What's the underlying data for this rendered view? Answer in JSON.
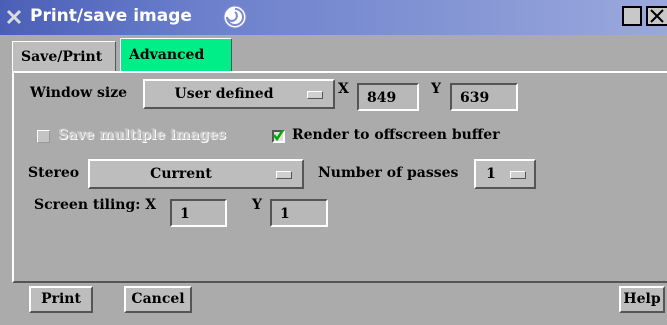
{
  "window": {
    "title": "Print/save image"
  },
  "tabs": [
    {
      "label": "Save/Print"
    },
    {
      "label": "Advanced"
    }
  ],
  "window_size": {
    "label": "Window size",
    "menu_value": "User defined",
    "x_label": "X",
    "x_value": "849",
    "y_label": "Y",
    "y_value": "639"
  },
  "save_multiple": {
    "label": "Save multiple images",
    "checked": false,
    "enabled": false
  },
  "offscreen": {
    "label": "Render to offscreen buffer",
    "checked": true
  },
  "stereo": {
    "label": "Stereo",
    "menu_value": "Current"
  },
  "passes": {
    "label": "Number of passes",
    "menu_value": "1"
  },
  "tiling": {
    "label": "Screen tiling: X",
    "x_value": "1",
    "y_label": "Y",
    "y_value": "1"
  },
  "buttons": {
    "print": "Print",
    "cancel": "Cancel",
    "help": "Help"
  },
  "colors": {
    "active_tab": "#00ee88",
    "check": "#00aa00"
  }
}
